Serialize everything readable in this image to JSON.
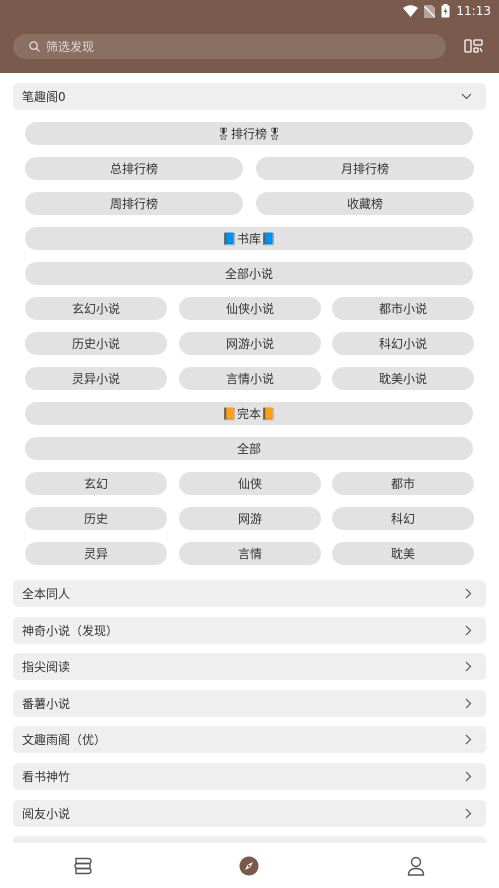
{
  "status_bar": {
    "time": "11:13"
  },
  "search": {
    "placeholder": "筛选发现"
  },
  "expanded_group": {
    "title": "笔趣阁0",
    "chips": {
      "rank_header": "🎖排行榜🎖",
      "total_rank": "总排行榜",
      "month_rank": "月排行榜",
      "week_rank": "周排行榜",
      "collect_rank": "收藏榜",
      "library_header": "📘书库📘",
      "all_novels": "全部小说",
      "xuanhuan_novel": "玄幻小说",
      "xianxia_novel": "仙侠小说",
      "dushi_novel": "都市小说",
      "lishi_novel": "历史小说",
      "wangyou_novel": "网游小说",
      "kehuan_novel": "科幻小说",
      "lingyi_novel": "灵异小说",
      "yanqing_novel": "言情小说",
      "danmei_novel": "耽美小说",
      "finished_header": "📙完本📙",
      "all": "全部",
      "xuanhuan": "玄幻",
      "xianxia": "仙侠",
      "dushi": "都市",
      "lishi": "历史",
      "wangyou": "网游",
      "kehuan": "科幻",
      "lingyi": "灵异",
      "yanqing": "言情",
      "danmei": "耽美"
    }
  },
  "groups": [
    {
      "title": "全本同人"
    },
    {
      "title": "神奇小说（发现）"
    },
    {
      "title": "指尖阅读"
    },
    {
      "title": "番薯小说"
    },
    {
      "title": "文趣雨阁（优）"
    },
    {
      "title": "看书神竹"
    },
    {
      "title": "阅友小说"
    },
    {
      "title": ""
    }
  ],
  "colors": {
    "app_bar": "#7a5a4c",
    "chip_bg": "#e2e2e2",
    "group_bg": "#efefef",
    "active_tab": "#7a5a4c"
  },
  "icons": {
    "search": "search-icon",
    "group_action": "group-icon",
    "expanded": "chevron-down-icon",
    "collapsed": "chevron-right-icon",
    "nav_bookshelf": "bookshelf-icon",
    "nav_discover": "compass-icon",
    "nav_mine": "person-icon"
  }
}
